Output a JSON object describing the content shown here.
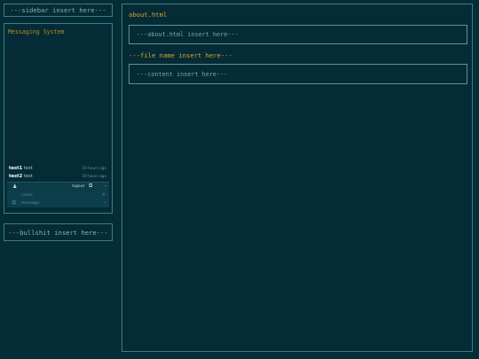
{
  "sidebar": {
    "header": "---sidebar insert here---",
    "footer": "---bullshit insert here---"
  },
  "chat": {
    "title": "Messaging System",
    "messages": [
      {
        "user": "test1",
        "text": "test",
        "time": "19 hours ago"
      },
      {
        "user": "test2",
        "text": "test",
        "time": "19 hours ago"
      }
    ],
    "toolbar": {
      "logout_label": "logout"
    },
    "name_placeholder": "name",
    "message_placeholder": "message"
  },
  "main": {
    "page_title": "about.html",
    "about_placeholder": "---about.html insert here---",
    "file_name_label": "---file name insert here---",
    "content_placeholder": "---content insert here---"
  }
}
